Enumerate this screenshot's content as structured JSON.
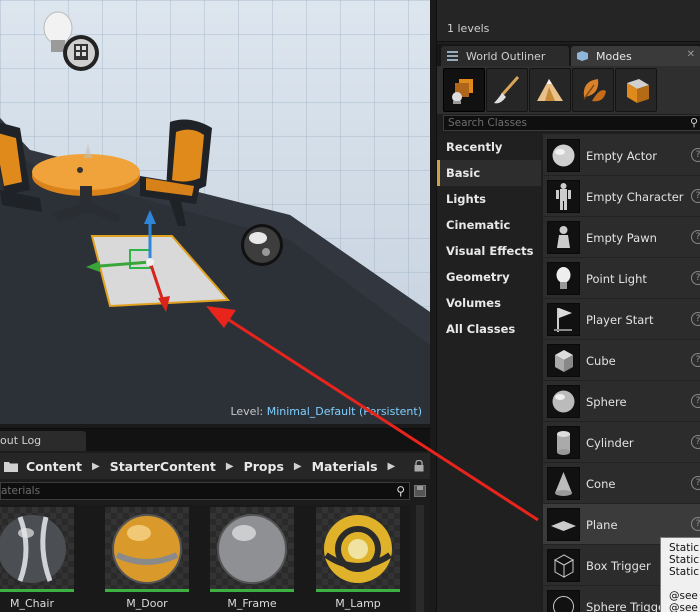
{
  "viewport": {
    "level_prefix": "Level:",
    "level_value": "Minimal_Default (Persistent)"
  },
  "levels": {
    "count": "1 levels"
  },
  "tabs": {
    "world_outliner": "World Outliner",
    "modes": "Modes"
  },
  "modes": {
    "buttons": [
      "place-mode",
      "paint-mode",
      "landscape-mode",
      "foliage-mode",
      "geometry-edit-mode"
    ],
    "active": "place-mode"
  },
  "search_classes": {
    "placeholder": "Search Classes"
  },
  "categories": [
    "Recently Placed",
    "Basic",
    "Lights",
    "Cinematic",
    "Visual Effects",
    "Geometry",
    "Volumes",
    "All Classes"
  ],
  "active_category": "Basic",
  "classes": [
    "Empty Actor",
    "Empty Character",
    "Empty Pawn",
    "Point Light",
    "Player Start",
    "Cube",
    "Sphere",
    "Cylinder",
    "Cone",
    "Plane",
    "Box Trigger",
    "Sphere Trigger"
  ],
  "selected_class": "Plane",
  "tooltip": {
    "lines": [
      "StaticM",
      "Static",
      "Static",
      "",
      "@see",
      "@see"
    ]
  },
  "content_browser": {
    "tab_label": "out Log",
    "breadcrumb": [
      "Content",
      "StarterContent",
      "Props",
      "Materials"
    ],
    "search_placeholder": "aterials",
    "assets": [
      "M_Chair",
      "M_Door",
      "M_Frame",
      "M_Lamp"
    ]
  },
  "colors": {
    "accent_gold": "#c9a24a",
    "annotation_arrow": "#e8241c",
    "asset_bar": "#3cb043"
  }
}
